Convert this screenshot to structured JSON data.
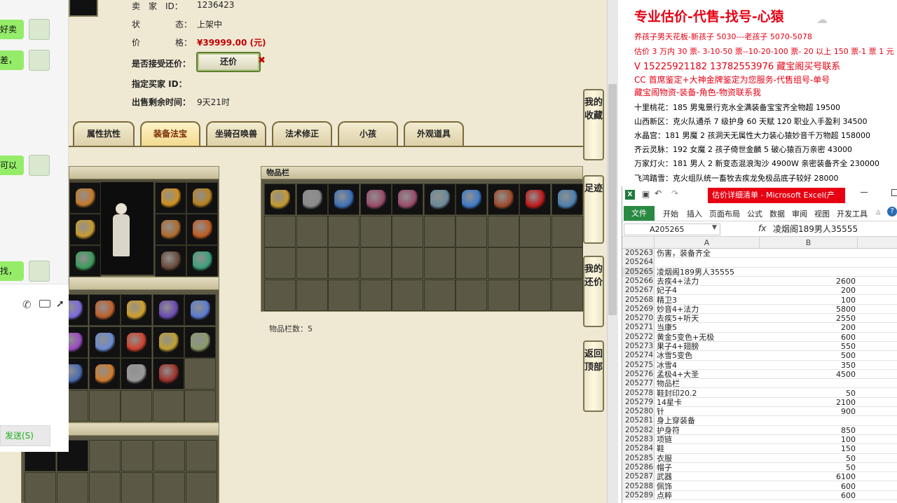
{
  "listing": {
    "seller_id_label": "卖　家　ID：",
    "seller_id": "1236423",
    "status_k1": "状",
    "status_k2": "态：",
    "status": "上架中",
    "price_k1": "价",
    "price_k2": "格：",
    "price": "¥39999.00 (元)",
    "bargain_label": "是否接受还价：",
    "bargain_button": "还价",
    "buyer_label": "指定买家 ID：",
    "time_label": "出售剩余时间：",
    "time_left": "9天21时"
  },
  "tabs": [
    {
      "label": "属性抗性",
      "active": false
    },
    {
      "label": "装备法宝",
      "active": true
    },
    {
      "label": "坐骑召唤兽",
      "active": false
    },
    {
      "label": "法术修正",
      "active": false
    },
    {
      "label": "小孩",
      "active": false
    },
    {
      "label": "外观道具",
      "active": false
    }
  ],
  "inventory": {
    "title": "物品栏",
    "count_label": "物品栏数：5",
    "item_colors": [
      "#c69a2e",
      "#8a8a8a",
      "#3b6fb8",
      "#9a4a6a",
      "#9a4a6a",
      "#6a8a9a",
      "#3d7ac9",
      "#a04a2a",
      "#c01818",
      "#4a7fb0"
    ]
  },
  "side_buttons": [
    "我的收藏",
    "足迹",
    "我的还价",
    "返回顶部"
  ],
  "chat": {
    "bubbles": [
      "好卖",
      "差，",
      "可以",
      "找，"
    ],
    "send": "发送(S)"
  },
  "notes": {
    "heading": "专业估价-代售-找号-心猿",
    "lines": [
      {
        "text": "养孩子男天花板-新孩子 5030---老孩子 5070-5078",
        "red": true
      },
      {
        "text": "估价 3 万内 30 票- 3-10-50 票--10-20-100 票- 20 以上 150 票-1 票 1 元",
        "red": true
      },
      {
        "text": "V 15225921182      13782553976    藏宝阁买号联系",
        "red": true
      },
      {
        "text": "CC 首席鉴定+大神金牌鉴定为您服务-代售组号-单号",
        "red": true
      },
      {
        "text": "藏宝阁物资-装备-角色-物资联系我",
        "red": true
      },
      {
        "text": "十里桃花：185 男鬼景行克水全满装备宝宝齐全物超 19500",
        "red": false
      },
      {
        "text": "山西新区：克火队通杀 7 级护身 60 天赋 120 职业入手盈利 34500",
        "red": false
      },
      {
        "text": "水晶宫：181 男魔 2 孩洞天无属性大力装心猿妙音千万物超 158000",
        "red": false
      },
      {
        "text": "齐云灵脉：192 女魔 2 孩子倚世金麟 5 破心猿百万亲密 43000",
        "red": false
      },
      {
        "text": "万家灯火：181 男人 2 新变态混浪淘沙 4900W 亲密装备齐全 230000",
        "red": false
      },
      {
        "text": "飞鸿踏雪：克火组队统一畜牧去疾龙免极品底子较好 28000",
        "red": false
      }
    ]
  },
  "excel": {
    "title": "估价详细清单 - Microsoft Excel(产",
    "ribbon": [
      "开始",
      "插入",
      "页面布局",
      "公式",
      "数据",
      "审阅",
      "视图",
      "开发工具"
    ],
    "file_tab": "文件",
    "namebox": "A205265",
    "formula": "凌烟阁189男人35555",
    "col_a": "A",
    "col_b": "B",
    "rows": [
      {
        "n": "205263",
        "a": "伤害，装备齐全",
        "b": ""
      },
      {
        "n": "205264",
        "a": "",
        "b": ""
      },
      {
        "n": "205265",
        "a": "凌烟阁189男人35555",
        "b": ""
      },
      {
        "n": "205266",
        "a": "去疾4+法力",
        "b": "2600"
      },
      {
        "n": "205267",
        "a": "妃子4",
        "b": "200"
      },
      {
        "n": "205268",
        "a": "精卫3",
        "b": "100"
      },
      {
        "n": "205269",
        "a": "妙音4+法力",
        "b": "5800"
      },
      {
        "n": "205270",
        "a": "去疾5+听天",
        "b": "2550"
      },
      {
        "n": "205271",
        "a": "当康5",
        "b": "200"
      },
      {
        "n": "205272",
        "a": "黄金5变色+无极",
        "b": "600"
      },
      {
        "n": "205273",
        "a": "果子4+翅膀",
        "b": "550"
      },
      {
        "n": "205274",
        "a": "冰雪5变色",
        "b": "500"
      },
      {
        "n": "205275",
        "a": "冰雪4",
        "b": "350"
      },
      {
        "n": "205276",
        "a": "孟极4+大圣",
        "b": "4500"
      },
      {
        "n": "205277",
        "a": "物品栏",
        "b": ""
      },
      {
        "n": "205278",
        "a": "鞋封印20.2",
        "b": "50"
      },
      {
        "n": "205279",
        "a": "14星卡",
        "b": "2100"
      },
      {
        "n": "205280",
        "a": "针",
        "b": "900"
      },
      {
        "n": "205281",
        "a": "身上穿装备",
        "b": ""
      },
      {
        "n": "205282",
        "a": "护身符",
        "b": "850"
      },
      {
        "n": "205283",
        "a": "项链",
        "b": "100"
      },
      {
        "n": "205284",
        "a": "鞋",
        "b": "150"
      },
      {
        "n": "205285",
        "a": "衣服",
        "b": "50"
      },
      {
        "n": "205286",
        "a": "帽子",
        "b": "50"
      },
      {
        "n": "205287",
        "a": "武器",
        "b": "6100"
      },
      {
        "n": "205288",
        "a": "佩饰",
        "b": "600"
      },
      {
        "n": "205289",
        "a": "点粹",
        "b": "600"
      }
    ]
  }
}
